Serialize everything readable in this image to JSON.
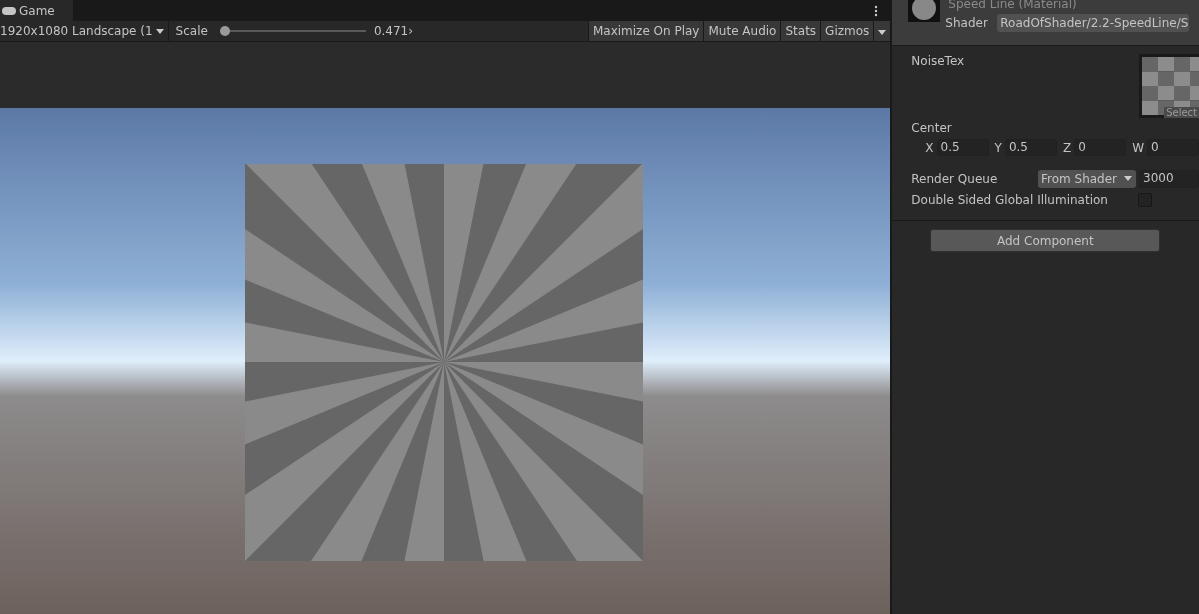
{
  "game_tab": {
    "label": "Game"
  },
  "toolbar": {
    "resolution": "1920x1080 Landscape (1",
    "scale_label": "Scale",
    "scale": {
      "level": 0.0
    },
    "scale_value": "0.471›",
    "buttons": [
      {
        "label": "Maximize On Play"
      },
      {
        "label": "Mute Audio"
      },
      {
        "label": "Stats"
      },
      {
        "label": "Gizmos"
      }
    ]
  },
  "inspector": {
    "material_title": "Speed Line (Material)",
    "shader_label": "Shader",
    "shader_value": "RoadOfShader/2.2-SpeedLine/S",
    "noise_label": "NoiseTex",
    "select_label": "Select",
    "center_label": "Center",
    "center": [
      {
        "axis": "X",
        "value": "0.5"
      },
      {
        "axis": "Y",
        "value": "0.5"
      },
      {
        "axis": "Z",
        "value": "0"
      },
      {
        "axis": "W",
        "value": "0"
      }
    ],
    "render_queue_label": "Render Queue",
    "render_queue_mode": "From Shader",
    "render_queue_value": "3000",
    "double_sided_label": "Double Sided Global Illumination",
    "double_sided": {
      "checked": false
    },
    "add_component": "Add Component"
  }
}
